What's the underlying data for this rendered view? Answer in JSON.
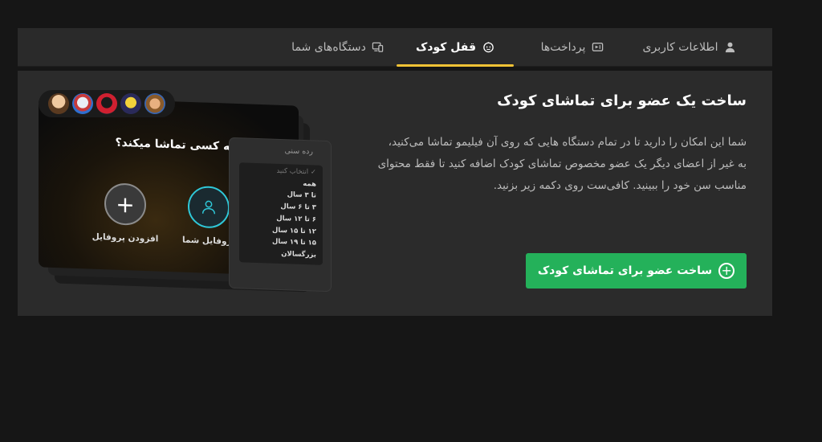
{
  "tabs": [
    {
      "label": "اطلاعات کاربری",
      "icon": "user-icon",
      "active": false
    },
    {
      "label": "پرداخت‌ها",
      "icon": "payment-icon",
      "active": false
    },
    {
      "label": "قفل کودک",
      "icon": "child-face-icon",
      "active": true
    },
    {
      "label": "دستگاه‌های شما",
      "icon": "devices-icon",
      "active": false
    }
  ],
  "main": {
    "title": "ساخت یک عضو برای تماشای کودک",
    "description": "شما این امکان را دارید تا در تمام دستگاه هایی که روی آن فیلیمو تماشا می‌کنید، به غیر از اعضای دیگر یک عضو مخصوص تماشای کودک اضافه کنید تا فقط محتوای مناسب سن خود را ببینید. کافی‌ست روی دکمه زیر بزنید.",
    "cta_label": "ساخت عضو برای تماشای کودک"
  },
  "illustration": {
    "question": "چه کسی تماشا میکند؟",
    "add_profile_label": "افزودن پروفایل",
    "your_profile_label": "پروفایل شما",
    "age_dropdown": {
      "title": "رده سنی",
      "options": [
        "انتخاب کنید",
        "همه",
        "تا ۳ سال",
        "۳ تا ۶ سال",
        "۶ تا ۱۲ سال",
        "۱۲ تا ۱۵ سال",
        "۱۵ تا ۱۹ سال",
        "بزرگسالان"
      ]
    }
  },
  "colors": {
    "accent": "#f2c335",
    "button": "#24b15a",
    "panel": "#2b2b2b",
    "background": "#161616"
  }
}
